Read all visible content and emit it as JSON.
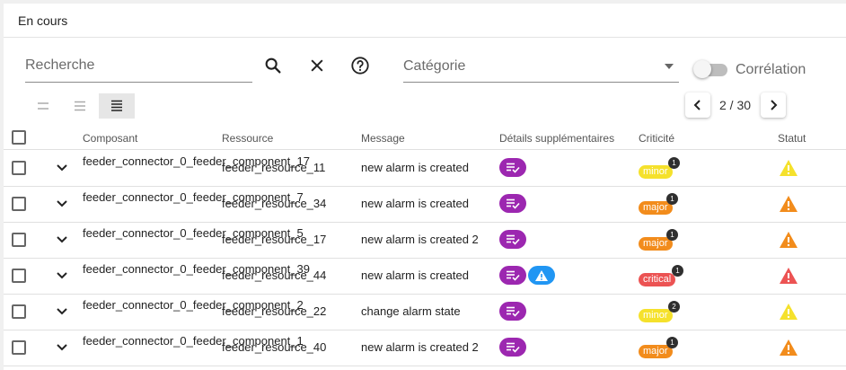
{
  "header": {
    "title": "En cours"
  },
  "search": {
    "placeholder": "Recherche"
  },
  "category": {
    "label": "Catégorie"
  },
  "correlation": {
    "label": "Corrélation",
    "enabled": false
  },
  "pagination": {
    "text": "2 / 30"
  },
  "colors": {
    "purple": "#9c27b0",
    "blue": "#2196f3",
    "minor": "#f5e12c",
    "major": "#f28c1c",
    "critical": "#ec5353"
  },
  "table": {
    "columns": {
      "component": "Composant",
      "resource": "Ressource",
      "message": "Message",
      "details": "Détails supplémentaires",
      "criticity": "Criticité",
      "status": "Statut"
    },
    "rows": [
      {
        "component": "feeder_connector_0_feeder_component_17",
        "resource": "feeder_resource_11",
        "message": "new alarm is created",
        "details": [
          "list-check-icon"
        ],
        "criticity": "minor",
        "count": "1",
        "status": "minor"
      },
      {
        "component": "feeder_connector_0_feeder_component_7",
        "resource": "feeder_resource_34",
        "message": "new alarm is created",
        "details": [
          "list-check-icon"
        ],
        "criticity": "major",
        "count": "1",
        "status": "major"
      },
      {
        "component": "feeder_connector_0_feeder_component_5",
        "resource": "feeder_resource_17",
        "message": "new alarm is created 2",
        "details": [
          "list-check-icon"
        ],
        "criticity": "major",
        "count": "1",
        "status": "major"
      },
      {
        "component": "feeder_connector_0_feeder_component_39",
        "resource": "feeder_resource_44",
        "message": "new alarm is created",
        "details": [
          "list-check-icon",
          "warning-icon"
        ],
        "criticity": "critical",
        "count": "1",
        "status": "critical"
      },
      {
        "component": "feeder_connector_0_feeder_component_2",
        "resource": "feeder_resource_22",
        "message": "change alarm state",
        "details": [
          "list-check-icon"
        ],
        "criticity": "minor",
        "count": "2",
        "status": "minor"
      },
      {
        "component": "feeder_connector_0_feeder_component_1",
        "resource": "feeder_resource_40",
        "message": "new alarm is created 2",
        "details": [
          "list-check-icon"
        ],
        "criticity": "major",
        "count": "1",
        "status": "major"
      }
    ]
  }
}
